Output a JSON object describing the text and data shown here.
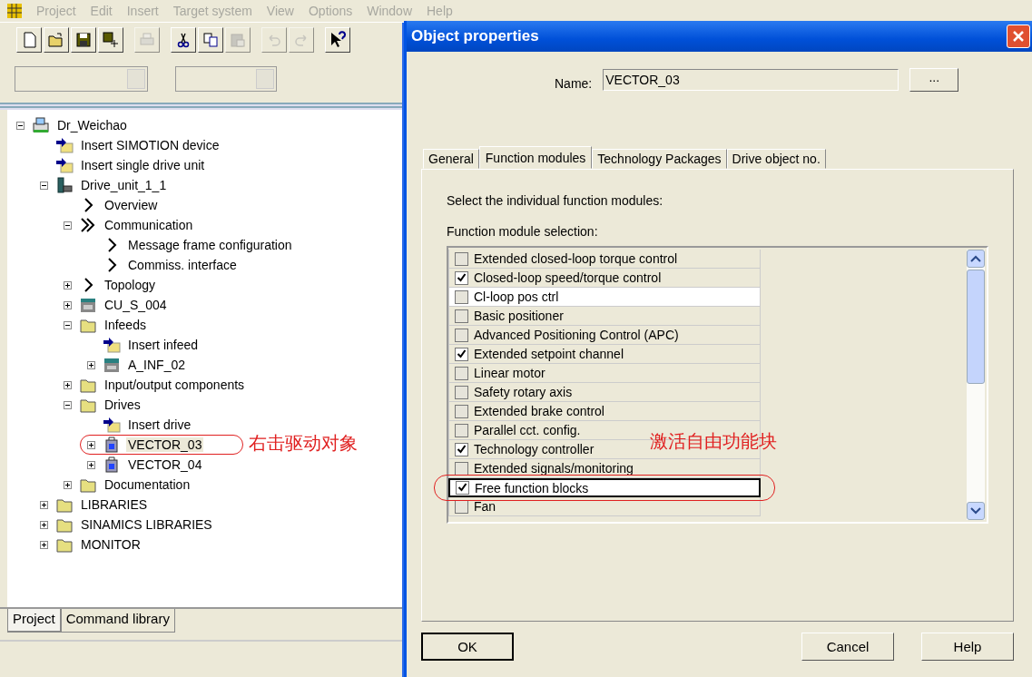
{
  "menu_bar": [
    "Project",
    "Edit",
    "Insert",
    "Target system",
    "View",
    "Options",
    "Window",
    "Help"
  ],
  "toolbar": [
    {
      "kind": "new",
      "disabled": false
    },
    {
      "kind": "open",
      "disabled": false
    },
    {
      "kind": "save",
      "disabled": false
    },
    {
      "kind": "compile",
      "disabled": false
    },
    {
      "kind": "print",
      "disabled": true
    },
    {
      "kind": "cut",
      "disabled": false
    },
    {
      "kind": "copy",
      "disabled": false
    },
    {
      "kind": "paste",
      "disabled": true
    },
    {
      "kind": "undo",
      "disabled": true
    },
    {
      "kind": "redo",
      "disabled": true
    },
    {
      "kind": "help",
      "disabled": false
    }
  ],
  "tree": [
    {
      "label": "Dr_Weichao",
      "kind": "device",
      "expanded": true,
      "selected": false,
      "children": [
        {
          "label": "Insert SIMOTION device",
          "kind": "insert",
          "selected": false
        },
        {
          "label": "Insert single drive unit",
          "kind": "insert",
          "selected": false
        },
        {
          "label": "Drive_unit_1_1",
          "kind": "drive-unit",
          "expanded": true,
          "selected": false,
          "children": [
            {
              "label": "Overview",
              "kind": "chevron",
              "selected": false
            },
            {
              "label": "Communication",
              "kind": "double-chevron",
              "expanded": true,
              "selected": false,
              "children": [
                {
                  "label": "Message frame configuration",
                  "kind": "chevron",
                  "selected": false
                },
                {
                  "label": "Commiss. interface",
                  "kind": "chevron",
                  "selected": false
                }
              ]
            },
            {
              "label": "Topology",
              "kind": "chevron",
              "expanded": false,
              "selected": false
            },
            {
              "label": "CU_S_004",
              "kind": "cu",
              "expanded": false,
              "selected": false
            },
            {
              "label": "Infeeds",
              "kind": "folder",
              "expanded": true,
              "selected": false,
              "children": [
                {
                  "label": "Insert infeed",
                  "kind": "insert",
                  "selected": false
                },
                {
                  "label": "A_INF_02",
                  "kind": "lm",
                  "expanded": false,
                  "selected": false
                }
              ]
            },
            {
              "label": "Input/output components",
              "kind": "folder",
              "expanded": false,
              "selected": false
            },
            {
              "label": "Drives",
              "kind": "folder",
              "expanded": true,
              "selected": false,
              "children": [
                {
                  "label": "Insert drive",
                  "kind": "insert",
                  "selected": false
                },
                {
                  "label": "VECTOR_03",
                  "kind": "drive",
                  "expanded": false,
                  "selected": true,
                  "note": "右击驱动对象"
                },
                {
                  "label": "VECTOR_04",
                  "kind": "drive",
                  "expanded": false,
                  "selected": false
                }
              ]
            },
            {
              "label": "Documentation",
              "kind": "folder",
              "expanded": false,
              "selected": false
            }
          ]
        },
        {
          "label": "LIBRARIES",
          "kind": "folder",
          "expanded": false,
          "selected": false
        },
        {
          "label": "SINAMICS LIBRARIES",
          "kind": "folder",
          "expanded": false,
          "selected": false
        },
        {
          "label": "MONITOR",
          "kind": "folder",
          "expanded": false,
          "selected": false
        }
      ]
    }
  ],
  "bottom_tabs": [
    {
      "label": "Project",
      "selected": true
    },
    {
      "label": "Command library",
      "selected": false
    }
  ],
  "dialog": {
    "title": "Object properties",
    "name_label": "Name:",
    "name_value": "VECTOR_03",
    "browse_button": "...",
    "tabs": [
      {
        "label": "General",
        "selected": false
      },
      {
        "label": "Function modules",
        "selected": true
      },
      {
        "label": "Technology Packages",
        "selected": false
      },
      {
        "label": "Drive object no.",
        "selected": false
      }
    ],
    "intro": "Select the individual function modules:",
    "list_label": "Function module selection:",
    "modules": [
      {
        "label": "Extended closed-loop torque control",
        "checked": false,
        "selected": false
      },
      {
        "label": "Closed-loop speed/torque control",
        "checked": true,
        "selected": false
      },
      {
        "label": "Cl-loop pos ctrl",
        "checked": false,
        "selected": true
      },
      {
        "label": "Basic positioner",
        "checked": false,
        "selected": false
      },
      {
        "label": "Advanced Positioning Control (APC)",
        "checked": false,
        "selected": false
      },
      {
        "label": "Extended setpoint channel",
        "checked": true,
        "selected": false
      },
      {
        "label": "Linear motor",
        "checked": false,
        "selected": false
      },
      {
        "label": "Safety rotary axis",
        "checked": false,
        "selected": false
      },
      {
        "label": "Extended brake control",
        "checked": false,
        "selected": false
      },
      {
        "label": "Parallel cct. config.",
        "checked": false,
        "selected": false
      },
      {
        "label": "Technology controller",
        "checked": true,
        "selected": false
      },
      {
        "label": "Extended signals/monitoring",
        "checked": false,
        "selected": false
      },
      {
        "label": "Free function blocks",
        "checked": true,
        "selected": true,
        "note": "激活自由功能块"
      },
      {
        "label": "Fan",
        "checked": false,
        "selected": false
      }
    ],
    "buttons": [
      {
        "label": "OK",
        "focused": true
      },
      {
        "label": "Cancel",
        "focused": false
      },
      {
        "label": "Help",
        "focused": false
      }
    ]
  }
}
